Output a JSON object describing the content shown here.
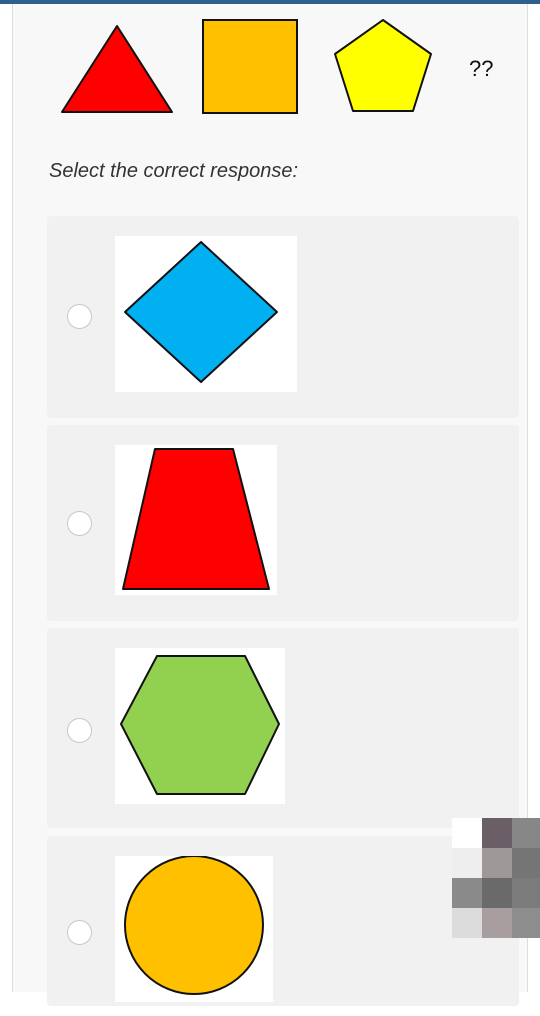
{
  "sequence": {
    "shapes": [
      {
        "icon": "red-triangle-icon",
        "color": "#ff0000"
      },
      {
        "icon": "orange-square-icon",
        "color": "#ffc000"
      },
      {
        "icon": "yellow-pentagon-icon",
        "color": "#ffff00"
      }
    ],
    "unknown": "??"
  },
  "prompt": "Select the correct response:",
  "options": [
    {
      "icon": "blue-diamond-icon",
      "color": "#00b0f0",
      "selected": false
    },
    {
      "icon": "red-trapezoid-icon",
      "color": "#ff0000",
      "selected": false
    },
    {
      "icon": "green-hexagon-icon",
      "color": "#92d050",
      "selected": false
    },
    {
      "icon": "orange-circle-icon",
      "color": "#ffc000",
      "selected": false
    }
  ]
}
